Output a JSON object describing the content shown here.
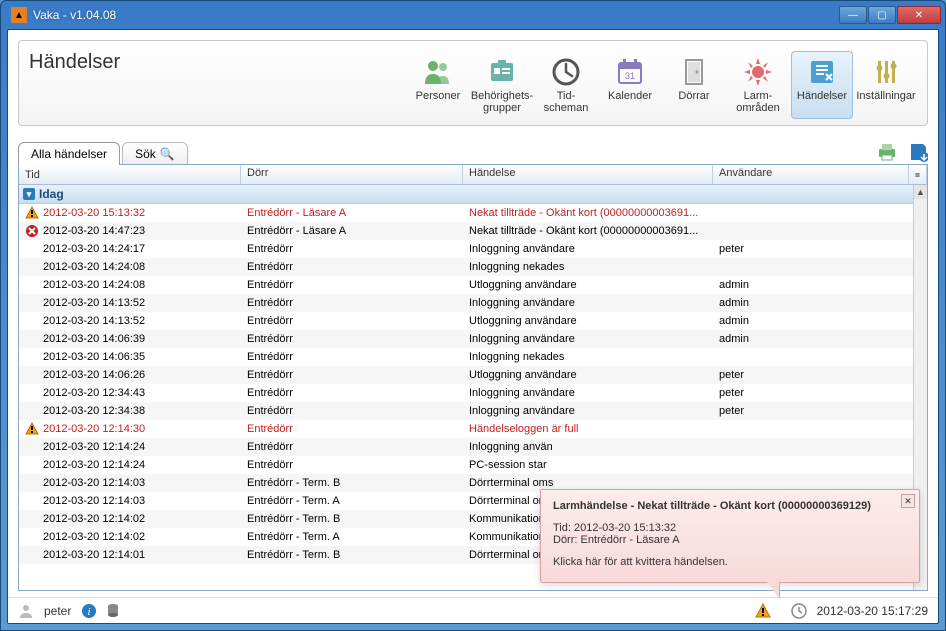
{
  "window": {
    "title": "Vaka - v1.04.08"
  },
  "page": {
    "title": "Händelser"
  },
  "toolbar": [
    {
      "id": "personer",
      "label": "Personer",
      "icon": "people-icon",
      "color": "#69b36b",
      "active": false
    },
    {
      "id": "behorighet",
      "label": "Behörighets-grupper",
      "icon": "badge-icon",
      "color": "#69b3a8",
      "active": false
    },
    {
      "id": "tidscheman",
      "label": "Tid-scheman",
      "icon": "clock-icon",
      "color": "#555",
      "active": false
    },
    {
      "id": "kalender",
      "label": "Kalender",
      "icon": "calendar-icon",
      "color": "#8a7ac0",
      "active": false
    },
    {
      "id": "dorrar",
      "label": "Dörrar",
      "icon": "door-icon",
      "color": "#999",
      "active": false
    },
    {
      "id": "larmomraden",
      "label": "Larm-områden",
      "icon": "alarm-icon",
      "color": "#e06a6a",
      "active": false
    },
    {
      "id": "handelser",
      "label": "Händelser",
      "icon": "events-icon",
      "color": "#4aa0d0",
      "active": true
    },
    {
      "id": "installningar",
      "label": "Inställningar",
      "icon": "sliders-icon",
      "color": "#c0b050",
      "active": false
    }
  ],
  "tabs": {
    "all": "Alla händelser",
    "search": "Sök"
  },
  "columns": {
    "tid": "Tid",
    "dorr": "Dörr",
    "handelse": "Händelse",
    "anvandare": "Användare"
  },
  "group_label": "Idag",
  "rows": [
    {
      "icon": "warn",
      "tid": "2012-03-20 15:13:32",
      "dorr": "Entrédörr - Läsare A",
      "handelse": "Nekat tillträde - Okänt kort (00000000003691...",
      "anv": "",
      "warn": true
    },
    {
      "icon": "error",
      "tid": "2012-03-20 14:47:23",
      "dorr": "Entrédörr - Läsare A",
      "handelse": "Nekat tillträde - Okänt kort (00000000003691...",
      "anv": "",
      "warn": false
    },
    {
      "icon": "",
      "tid": "2012-03-20 14:24:17",
      "dorr": "Entrédörr",
      "handelse": "Inloggning användare",
      "anv": "peter",
      "warn": false
    },
    {
      "icon": "",
      "tid": "2012-03-20 14:24:08",
      "dorr": "Entrédörr",
      "handelse": "Inloggning nekades",
      "anv": "",
      "warn": false
    },
    {
      "icon": "",
      "tid": "2012-03-20 14:24:08",
      "dorr": "Entrédörr",
      "handelse": "Utloggning användare",
      "anv": "admin",
      "warn": false
    },
    {
      "icon": "",
      "tid": "2012-03-20 14:13:52",
      "dorr": "Entrédörr",
      "handelse": "Inloggning användare",
      "anv": "admin",
      "warn": false
    },
    {
      "icon": "",
      "tid": "2012-03-20 14:13:52",
      "dorr": "Entrédörr",
      "handelse": "Utloggning användare",
      "anv": "admin",
      "warn": false
    },
    {
      "icon": "",
      "tid": "2012-03-20 14:06:39",
      "dorr": "Entrédörr",
      "handelse": "Inloggning användare",
      "anv": "admin",
      "warn": false
    },
    {
      "icon": "",
      "tid": "2012-03-20 14:06:35",
      "dorr": "Entrédörr",
      "handelse": "Inloggning nekades",
      "anv": "",
      "warn": false
    },
    {
      "icon": "",
      "tid": "2012-03-20 14:06:26",
      "dorr": "Entrédörr",
      "handelse": "Utloggning användare",
      "anv": "peter",
      "warn": false
    },
    {
      "icon": "",
      "tid": "2012-03-20 12:34:43",
      "dorr": "Entrédörr",
      "handelse": "Inloggning användare",
      "anv": "peter",
      "warn": false
    },
    {
      "icon": "",
      "tid": "2012-03-20 12:34:38",
      "dorr": "Entrédörr",
      "handelse": "Inloggning användare",
      "anv": "peter",
      "warn": false
    },
    {
      "icon": "warn",
      "tid": "2012-03-20 12:14:30",
      "dorr": "Entrédörr",
      "handelse": "Händelseloggen är full",
      "anv": "",
      "warn": true
    },
    {
      "icon": "",
      "tid": "2012-03-20 12:14:24",
      "dorr": "Entrédörr",
      "handelse": "Inloggning använ",
      "anv": "",
      "warn": false
    },
    {
      "icon": "",
      "tid": "2012-03-20 12:14:24",
      "dorr": "Entrédörr",
      "handelse": "PC-session star",
      "anv": "",
      "warn": false
    },
    {
      "icon": "",
      "tid": "2012-03-20 12:14:03",
      "dorr": "Entrédörr - Term. B",
      "handelse": "Dörrterminal oms",
      "anv": "",
      "warn": false
    },
    {
      "icon": "",
      "tid": "2012-03-20 12:14:03",
      "dorr": "Entrédörr - Term. A",
      "handelse": "Dörrterminal oms",
      "anv": "",
      "warn": false
    },
    {
      "icon": "",
      "tid": "2012-03-20 12:14:02",
      "dorr": "Entrédörr - Term. B",
      "handelse": "Kommunikation s",
      "anv": "",
      "warn": false
    },
    {
      "icon": "",
      "tid": "2012-03-20 12:14:02",
      "dorr": "Entrédörr - Term. A",
      "handelse": "Kommunikation s",
      "anv": "",
      "warn": false
    },
    {
      "icon": "",
      "tid": "2012-03-20 12:14:01",
      "dorr": "Entrédörr - Term. B",
      "handelse": "Dörrterminal oms",
      "anv": "",
      "warn": false
    }
  ],
  "alarm_popup": {
    "title": "Larmhändelse - Nekat tillträde - Okänt kort (00000000369129)",
    "line1": "Tid: 2012-03-20 15:13:32",
    "line2": "Dörr: Entrédörr - Läsare A",
    "hint": "Klicka här för att kvittera händelsen."
  },
  "status": {
    "user": "peter",
    "datetime": "2012-03-20 15:17:29"
  }
}
